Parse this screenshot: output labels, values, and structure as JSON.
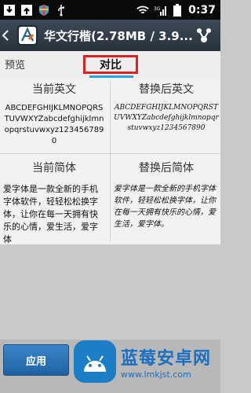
{
  "status_bar": {
    "time": "0:37"
  },
  "action_bar": {
    "title": "华文行楷(2.78MB / 3.9..."
  },
  "tabs": {
    "preview": "预览",
    "compare": "对比"
  },
  "english": {
    "current_header": "当前英文",
    "current_sample": "ABCDEFGHIJKLMNOPQRSTUVWXYZabcdefghijklmnopqrstuvwxyz1234567890",
    "replaced_header": "替换后英文",
    "replaced_sample": "ABCDEFGHIJKLMNOPQRSTUVWXYZabcdefghijklmnopqrstuvwxyz1234567890"
  },
  "chinese": {
    "current_header": "当前简体",
    "current_sample": "爱字体是一款全新的手机字体软件，轻轻松松换字体，让你在每一天拥有快乐的心情，爱生活，爱字体",
    "replaced_header": "替换后简体",
    "replaced_sample": "爱字体是一款全新的手机字体软件，轻轻松松换字体，让你在每一天拥有快乐的心情，爱生活，爱字体。"
  },
  "bottom": {
    "apply": "应用"
  },
  "watermark": {
    "name": "蓝莓安卓网",
    "url": "www.lmkjst.com"
  }
}
